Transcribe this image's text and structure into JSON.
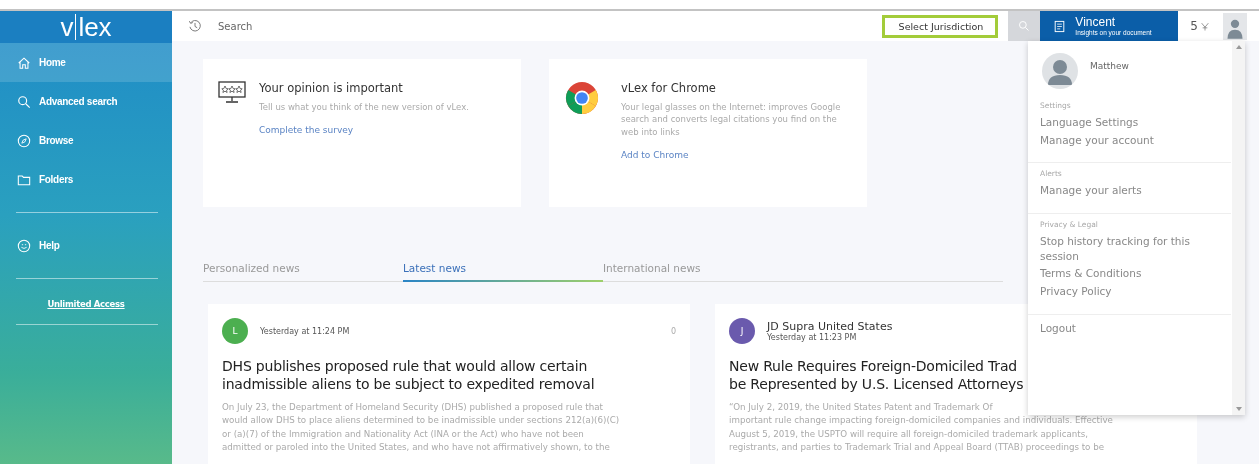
{
  "sidebar": {
    "logo": [
      "v",
      "lex"
    ],
    "nav": [
      {
        "label": "Home",
        "kind": "home",
        "selected": true
      },
      {
        "label": "Advanced search",
        "kind": "search",
        "selected": false
      },
      {
        "label": "Browse",
        "kind": "compass",
        "selected": false
      },
      {
        "label": "Folders",
        "kind": "folder",
        "selected": false
      }
    ],
    "help": {
      "label": "Help",
      "kind": "help",
      "selected": false
    },
    "access_link": "Unlimited Access"
  },
  "topbar": {
    "search": {
      "placeholder": "Search"
    },
    "jurisdiction": {
      "placeholder": "Select Jurisdiction",
      "highlighted": true
    },
    "vincent": {
      "title": "Vincent",
      "subtitle": "Insights on your document"
    },
    "count": "5"
  },
  "promos": [
    {
      "kind": "survey",
      "title": "Your opinion is important",
      "text": "Tell us what you think of the new version of vLex.",
      "link": "Complete the survey"
    },
    {
      "kind": "chrome",
      "title": "vLex for Chrome",
      "text": "Your legal glasses on the Internet: improves Google search and converts legal citations you find on the web into links",
      "link": "Add to Chrome"
    }
  ],
  "tabs": [
    {
      "label": "Personalized news",
      "selected": false
    },
    {
      "label": "Latest news",
      "selected": true
    },
    {
      "label": "International news",
      "selected": false
    }
  ],
  "news": [
    {
      "initial": "L",
      "color": "#4caf50",
      "time": "Yesterday at 11:24 PM",
      "count": "0",
      "title_lines": [
        "DHS publishes proposed rule that would allow certain",
        "inadmissible aliens to be subject to expedited removal"
      ],
      "body_lines": [
        "On July 23, the Department of Homeland Security (DHS) published a proposed rule that",
        "would allow DHS to place aliens determined to be inadmissible under sections 212(a)(6)(C)",
        "or (a)(7) of the Immigration and Nationality Act (INA or the Act) who have not been",
        "admitted or paroled into the United States, and who have not affirmatively shown, to the"
      ]
    },
    {
      "initial": "J",
      "color": "#6a5aad",
      "source": "JD Supra United States",
      "time": "Yesterday at 11:23 PM",
      "title_lines": [
        "New Rule Requires Foreign-Domiciled Trad",
        "be Represented by U.S. Licensed Attorneys"
      ],
      "body_lines": [
        "“On July 2, 2019, the United States Patent and Trademark Of",
        "important rule change impacting foreign-domiciled companies and individuals. Effective",
        "August 5, 2019, the USPTO will require all foreign-domiciled trademark applicants,",
        "registrants, and parties to Trademark Trial and Appeal Board (TTAB) proceedings to be"
      ]
    }
  ],
  "user_menu": {
    "name": "Matthew",
    "sections": [
      {
        "heading": "Settings",
        "items": [
          "Language Settings",
          "Manage your account"
        ]
      },
      {
        "heading": "Alerts",
        "items": [
          "Manage your alerts"
        ]
      },
      {
        "heading": "Privacy & Legal",
        "items": [
          "Stop history tracking for this session",
          "Terms & Conditions",
          "Privacy Policy"
        ]
      },
      {
        "items": [
          "Logout"
        ]
      }
    ]
  }
}
